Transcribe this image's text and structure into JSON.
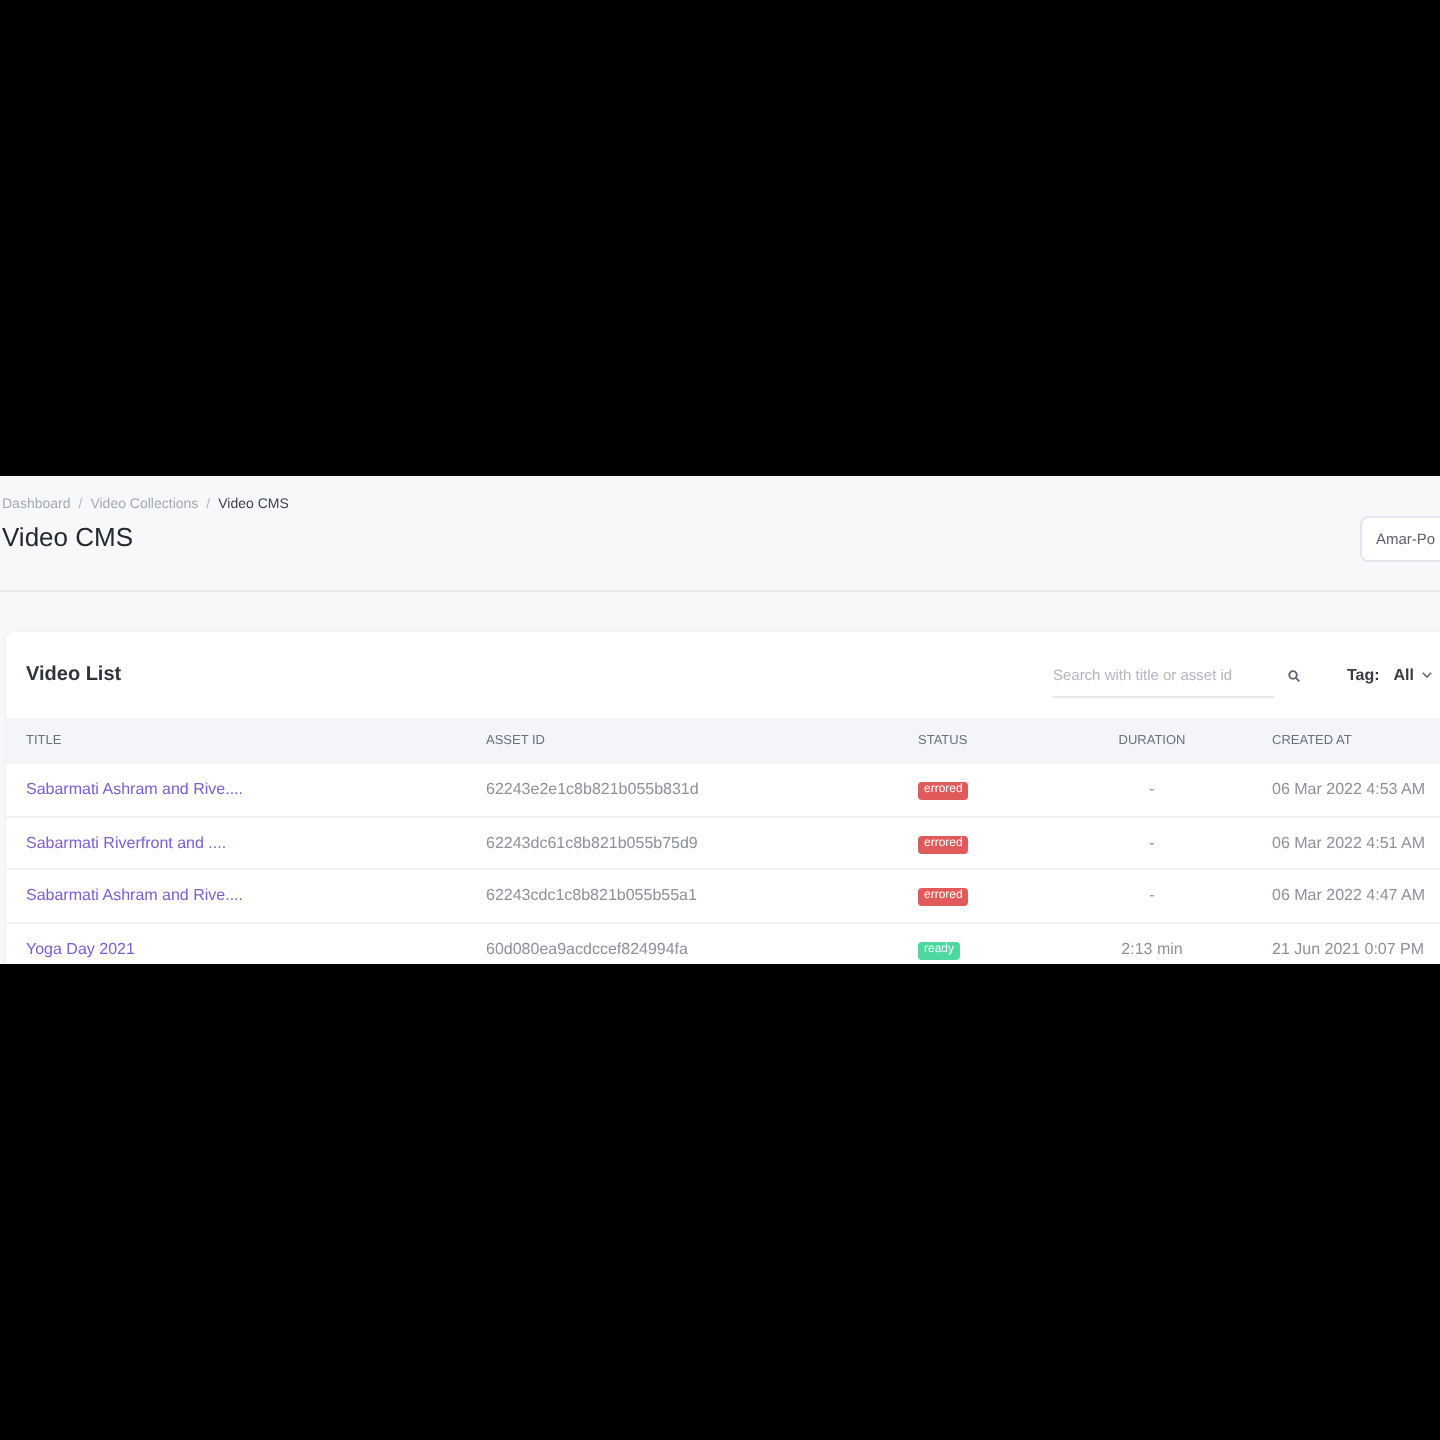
{
  "breadcrumb": [
    {
      "kind": "link",
      "label": "Dashboard"
    },
    {
      "kind": "separator",
      "label": "/"
    },
    {
      "kind": "link",
      "label": "Video Collections"
    },
    {
      "kind": "separator",
      "label": "/"
    },
    {
      "kind": "current",
      "label": "Video CMS"
    }
  ],
  "page": {
    "title": "Video CMS",
    "header_button": "Amar-Po"
  },
  "card": {
    "title": "Video List",
    "search": {
      "placeholder": "Search with title or asset id"
    },
    "filter": {
      "label": "Tag:",
      "value": "All"
    }
  },
  "table": {
    "columns": [
      "TITLE",
      "ASSET ID",
      "STATUS",
      "DURATION",
      "CREATED AT"
    ],
    "rows": [
      {
        "title": "Sabarmati Ashram and Rive....",
        "asset_id": "62243e2e1c8b821b055b831d",
        "status": {
          "label": "errored",
          "color": "#e05a5a"
        },
        "duration": "-",
        "created_at": "06 Mar 2022 4:53 AM"
      },
      {
        "title": "Sabarmati Riverfront and ....",
        "asset_id": "62243dc61c8b821b055b75d9",
        "status": {
          "label": "errored",
          "color": "#e05a5a"
        },
        "duration": "-",
        "created_at": "06 Mar 2022 4:51 AM"
      },
      {
        "title": "Sabarmati Ashram and Rive....",
        "asset_id": "62243cdc1c8b821b055b55a1",
        "status": {
          "label": "errored",
          "color": "#e05a5a"
        },
        "duration": "-",
        "created_at": "06 Mar 2022 4:47 AM"
      },
      {
        "title": "Yoga Day 2021",
        "asset_id": "60d080ea9acdccef824994fa",
        "status": {
          "label": "ready",
          "color": "#4ed8a0"
        },
        "duration": "2:13 min",
        "created_at": "21 Jun 2021 0:07 PM"
      }
    ]
  }
}
